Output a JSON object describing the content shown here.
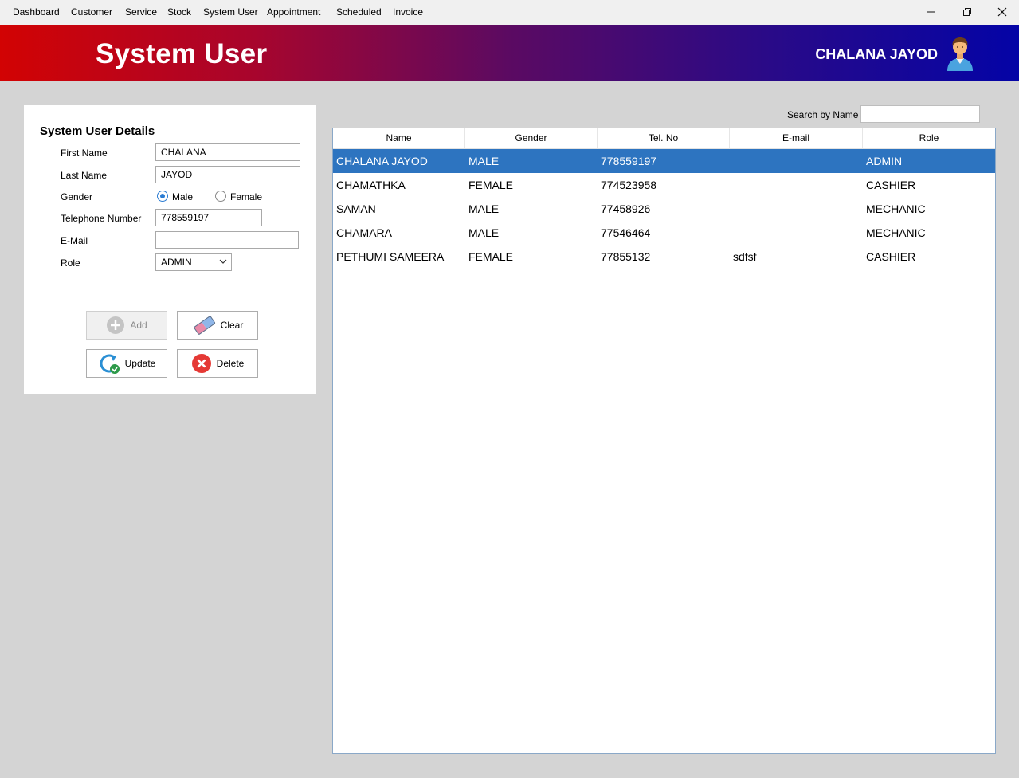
{
  "menu": [
    "Dashboard",
    "Customer",
    "Service",
    "Stock",
    "System User",
    "Appointment",
    "Scheduled",
    "Invoice"
  ],
  "window_controls": {
    "minimize": "—",
    "restore": "❐",
    "close": "✕"
  },
  "banner": {
    "title": "System User",
    "user": "CHALANA JAYOD",
    "avatar_icon": "user-avatar-icon"
  },
  "details": {
    "title": "System User Details",
    "labels": {
      "first_name": "First Name",
      "last_name": "Last Name",
      "gender": "Gender",
      "telephone": "Telephone Number",
      "email": "E-Mail",
      "role": "Role"
    },
    "values": {
      "first_name": "CHALANA",
      "last_name": "JAYOD",
      "telephone": "778559197",
      "email": "",
      "role": "ADMIN"
    },
    "gender_options": {
      "male": "Male",
      "female": "Female",
      "selected": "male"
    }
  },
  "buttons": {
    "add": "Add",
    "clear": "Clear",
    "update": "Update",
    "delete": "Delete"
  },
  "search": {
    "label": "Search by Name",
    "value": ""
  },
  "table": {
    "columns": [
      "Name",
      "Gender",
      "Tel. No",
      "E-mail",
      "Role"
    ],
    "rows": [
      [
        "CHALANA JAYOD",
        "MALE",
        "778559197",
        "",
        "ADMIN"
      ],
      [
        "CHAMATHKA",
        "FEMALE",
        "774523958",
        "",
        "CASHIER"
      ],
      [
        "SAMAN",
        "MALE",
        "77458926",
        "",
        "MECHANIC"
      ],
      [
        "CHAMARA",
        "MALE",
        "77546464",
        "",
        "MECHANIC"
      ],
      [
        "PETHUMI SAMEERA",
        "FEMALE",
        "77855132",
        "sdfsf",
        "CASHIER"
      ]
    ],
    "selected_row": 0
  },
  "colors": {
    "banner_start": "#d20303",
    "banner_end": "#0404a6",
    "selection": "#2d74c0",
    "radio_accent": "#2b7cd3"
  }
}
